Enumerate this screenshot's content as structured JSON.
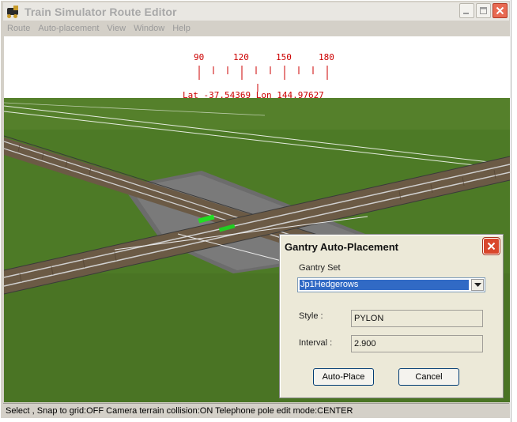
{
  "window": {
    "title": "Train Simulator Route Editor",
    "icon": "locomotive-icon"
  },
  "menu": [
    {
      "label": "Route"
    },
    {
      "label": "Auto-placement"
    },
    {
      "label": "View"
    },
    {
      "label": "Window"
    },
    {
      "label": "Help"
    }
  ],
  "compass": {
    "ticks": [
      "90",
      "120",
      "150",
      "180"
    ],
    "readout": "Lat -37.54369 Lon 144.97627",
    "color": "#cc0000"
  },
  "scene": {
    "grass_color": "#4d7a26",
    "sky_color": "#ffffff"
  },
  "dialog": {
    "title": "Gantry Auto-Placement",
    "gantry_set_label": "Gantry Set",
    "gantry_set_value": "Jp1Hedgerows",
    "style_label": "Style :",
    "style_value": "PYLON",
    "interval_label": "Interval :",
    "interval_value": "2.900",
    "auto_place_label": "Auto-Place",
    "cancel_label": "Cancel"
  },
  "status": {
    "text": "Select , Snap to grid:OFF Camera terrain collision:ON Telephone pole edit mode:CENTER"
  }
}
